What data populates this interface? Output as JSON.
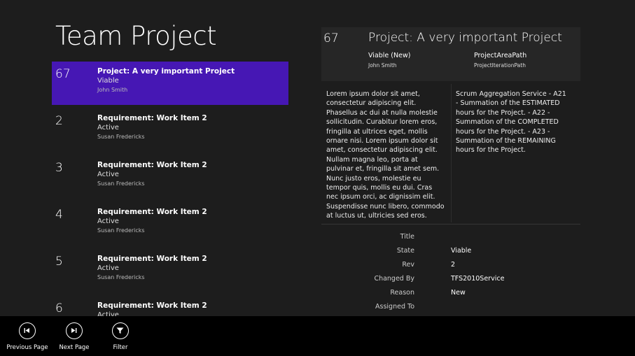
{
  "page": {
    "title": "Team Project"
  },
  "work_items": [
    {
      "id": "67",
      "title": "Project: A very important Project",
      "state": "Viable",
      "person": "John Smith"
    },
    {
      "id": "2",
      "title": "Requirement: Work Item 2",
      "state": "Active",
      "person": "Susan Fredericks"
    },
    {
      "id": "3",
      "title": "Requirement: Work Item 2",
      "state": "Active",
      "person": "Susan Fredericks"
    },
    {
      "id": "4",
      "title": "Requirement: Work Item 2",
      "state": "Active",
      "person": "Susan Fredericks"
    },
    {
      "id": "5",
      "title": "Requirement: Work Item 2",
      "state": "Active",
      "person": "Susan Fredericks"
    },
    {
      "id": "6",
      "title": "Requirement: Work Item 2",
      "state": "Active",
      "person": ""
    }
  ],
  "detail": {
    "id": "67",
    "title": "Project: A very important Project",
    "state_label": "Viable (New)",
    "assigned": "John Smith",
    "area_path": "ProjectAreaPath",
    "iteration_path": "ProjectIterationPath",
    "description": "Lorem ipsum dolor sit amet, consectetur adipiscing elit. Phasellus ac dui at nulla molestie sollicitudin. Curabitur lorem eros, fringilla at ultrices eget, mollis ornare nisi. Lorem ipsum dolor sit amet, consectetur adipiscing elit. Nullam magna leo, porta at pulvinar et, fringilla sit amet sem. Nunc justo eros, molestie eu tempor quis, mollis eu dui. Cras nec ipsum orci, ac dignissim elit. Suspendisse nunc libero, commodo at luctus ut, ultricies sed eros.",
    "aggregation": "Scrum Aggregation Service - A21 - Summation of the ESTIMATED hours for the Project. - A22 - Summation of the COMPLETED hours for the Project. - A23 - Summation of the REMAINING hours for the Project.",
    "fields": [
      {
        "label": "Title",
        "value": ""
      },
      {
        "label": "State",
        "value": "Viable"
      },
      {
        "label": "Rev",
        "value": "2"
      },
      {
        "label": "Changed By",
        "value": "TFS2010Service"
      },
      {
        "label": "Reason",
        "value": "New"
      },
      {
        "label": "Assigned To",
        "value": ""
      }
    ]
  },
  "appbar": {
    "previous_label": "Previous Page",
    "next_label": "Next Page",
    "filter_label": "Filter"
  },
  "icons": {
    "previous": "skip-back-icon",
    "next": "skip-forward-icon",
    "filter": "filter-icon"
  },
  "colors": {
    "selected": "#4617b4",
    "background": "#1d1d1d",
    "appbar": "#000000"
  }
}
